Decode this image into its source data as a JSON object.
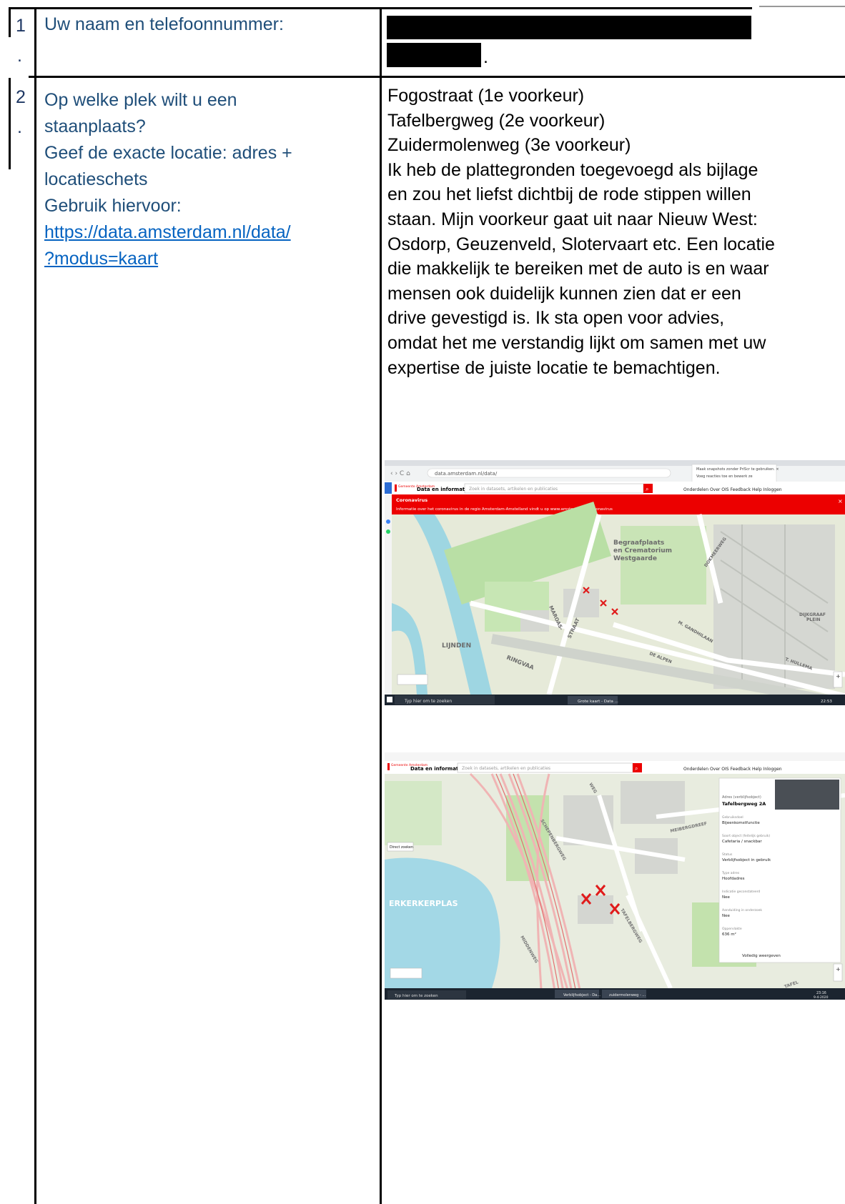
{
  "row1": {
    "number": "1",
    "dot": ".",
    "question": "Uw naam en telefoonnummer:",
    "answer_trailing": "."
  },
  "row2": {
    "number": "2",
    "dot": ".",
    "question_lines": [
      "Op welke plek wilt u een",
      "staanplaats?",
      "Geef de exacte locatie: adres +",
      "locatieschets",
      "Gebruik hiervoor:"
    ],
    "link_lines": [
      "https://data.amsterdam.nl/data/",
      "?modus=kaart"
    ],
    "answer_lines": [
      "Fogostraat (1e voorkeur)",
      "Tafelbergweg (2e voorkeur)",
      "Zuidermolenweg (3e voorkeur)",
      "Ik heb de plattegronden toegevoegd als bijlage",
      "en zou het liefst dichtbij de rode stippen willen",
      "staan. Mijn voorkeur gaat uit naar Nieuw West:",
      "Osdorp, Geuzenveld, Slotervaart etc. Een locatie",
      "die makkelijk te bereiken met de auto is en waar",
      "mensen ook duidelijk kunnen zien dat er een",
      "drive gevestigd is. Ik sta open voor advies,",
      "omdat het me verstandig lijkt om samen met uw",
      "expertise de juiste locatie te bemachtigen."
    ]
  },
  "map1": {
    "brand": "Gemeente Amsterdam",
    "site_title": "Data en informatie",
    "search_placeholder": "Zoek in datasets, artikelen en publicaties",
    "nav": "Onderdelen   Over OIS   Feedback   Help   Inloggen",
    "banner_title": "Coronavirus",
    "banner_text": "Informatie over het coronavirus in de regio Amsterdam-Amstelland vindt u op www.amsterdam.nl/coronavirus",
    "labels": {
      "cemetery_1": "Begraafplaats",
      "cemetery_2": "en Crematorium",
      "cemetery_3": "Westgaarde",
      "lijnden": "LIJNDEN",
      "maroas": "MAROAS-",
      "straat": "STRAAT",
      "ringvaart": "RINGVAA",
      "dijkgraaf_1": "DIJKGRAAF",
      "dijkgraaf_2": "PLEIN",
      "de_alpen": "DE ALPEN",
      "gandhi": "M. GANDHILAAN",
      "dokmeerweg": "DOKMEERWEG",
      "hullema": "T. HULLEMA"
    },
    "taskbar_search": "Typ hier om te zoeken",
    "taskbar_task": "Grote kaart - Data ...",
    "time": "22:53"
  },
  "map2": {
    "brand": "Gemeente Amsterdam",
    "site_title": "Data en informatie",
    "search_placeholder": "Zoek in datasets, artikelen en publicaties",
    "nav": "Onderdelen   Over OIS   Feedback   Help   Inloggen",
    "direct_button": "Direct zoeken",
    "labels": {
      "lake": "ERKERKERPLAS",
      "schepenbergweg": "SCHEPENBERGWEG",
      "meibergdreef": "MEIBERGDREEF",
      "middenweg": "MIDDENWEG",
      "tafelbergweg": "TAFELBERGWEG",
      "weg": "WEG",
      "tafel": "TAFEL"
    },
    "panel": {
      "heading": "Adres (verblijfsobject)",
      "address": "Tafelbergweg 2A",
      "fields": [
        {
          "label": "Gebruiksdoel",
          "value": "Bijeenkomstfunctie"
        },
        {
          "label": "Soort object (feitelijk gebruik)",
          "value": "Cafetaria / snackbar"
        },
        {
          "label": "Status",
          "value": "Verblijfsobject in gebruik"
        },
        {
          "label": "Type adres",
          "value": "Hoofdadres"
        },
        {
          "label": "Indicatie geconstateerd",
          "value": "Nee"
        },
        {
          "label": "Aanduiding in onderzoek",
          "value": "Nee"
        },
        {
          "label": "Oppervlakte",
          "value": "636 m²"
        }
      ],
      "full_view": "Volledig weergeven"
    },
    "taskbar_search": "Typ hier om te zoeken",
    "taskbar_task_1": "Verblijfsobject - Da...",
    "taskbar_task_2": "zuidermolenweg - ...",
    "time": "23:16",
    "date": "9-4-2020"
  }
}
